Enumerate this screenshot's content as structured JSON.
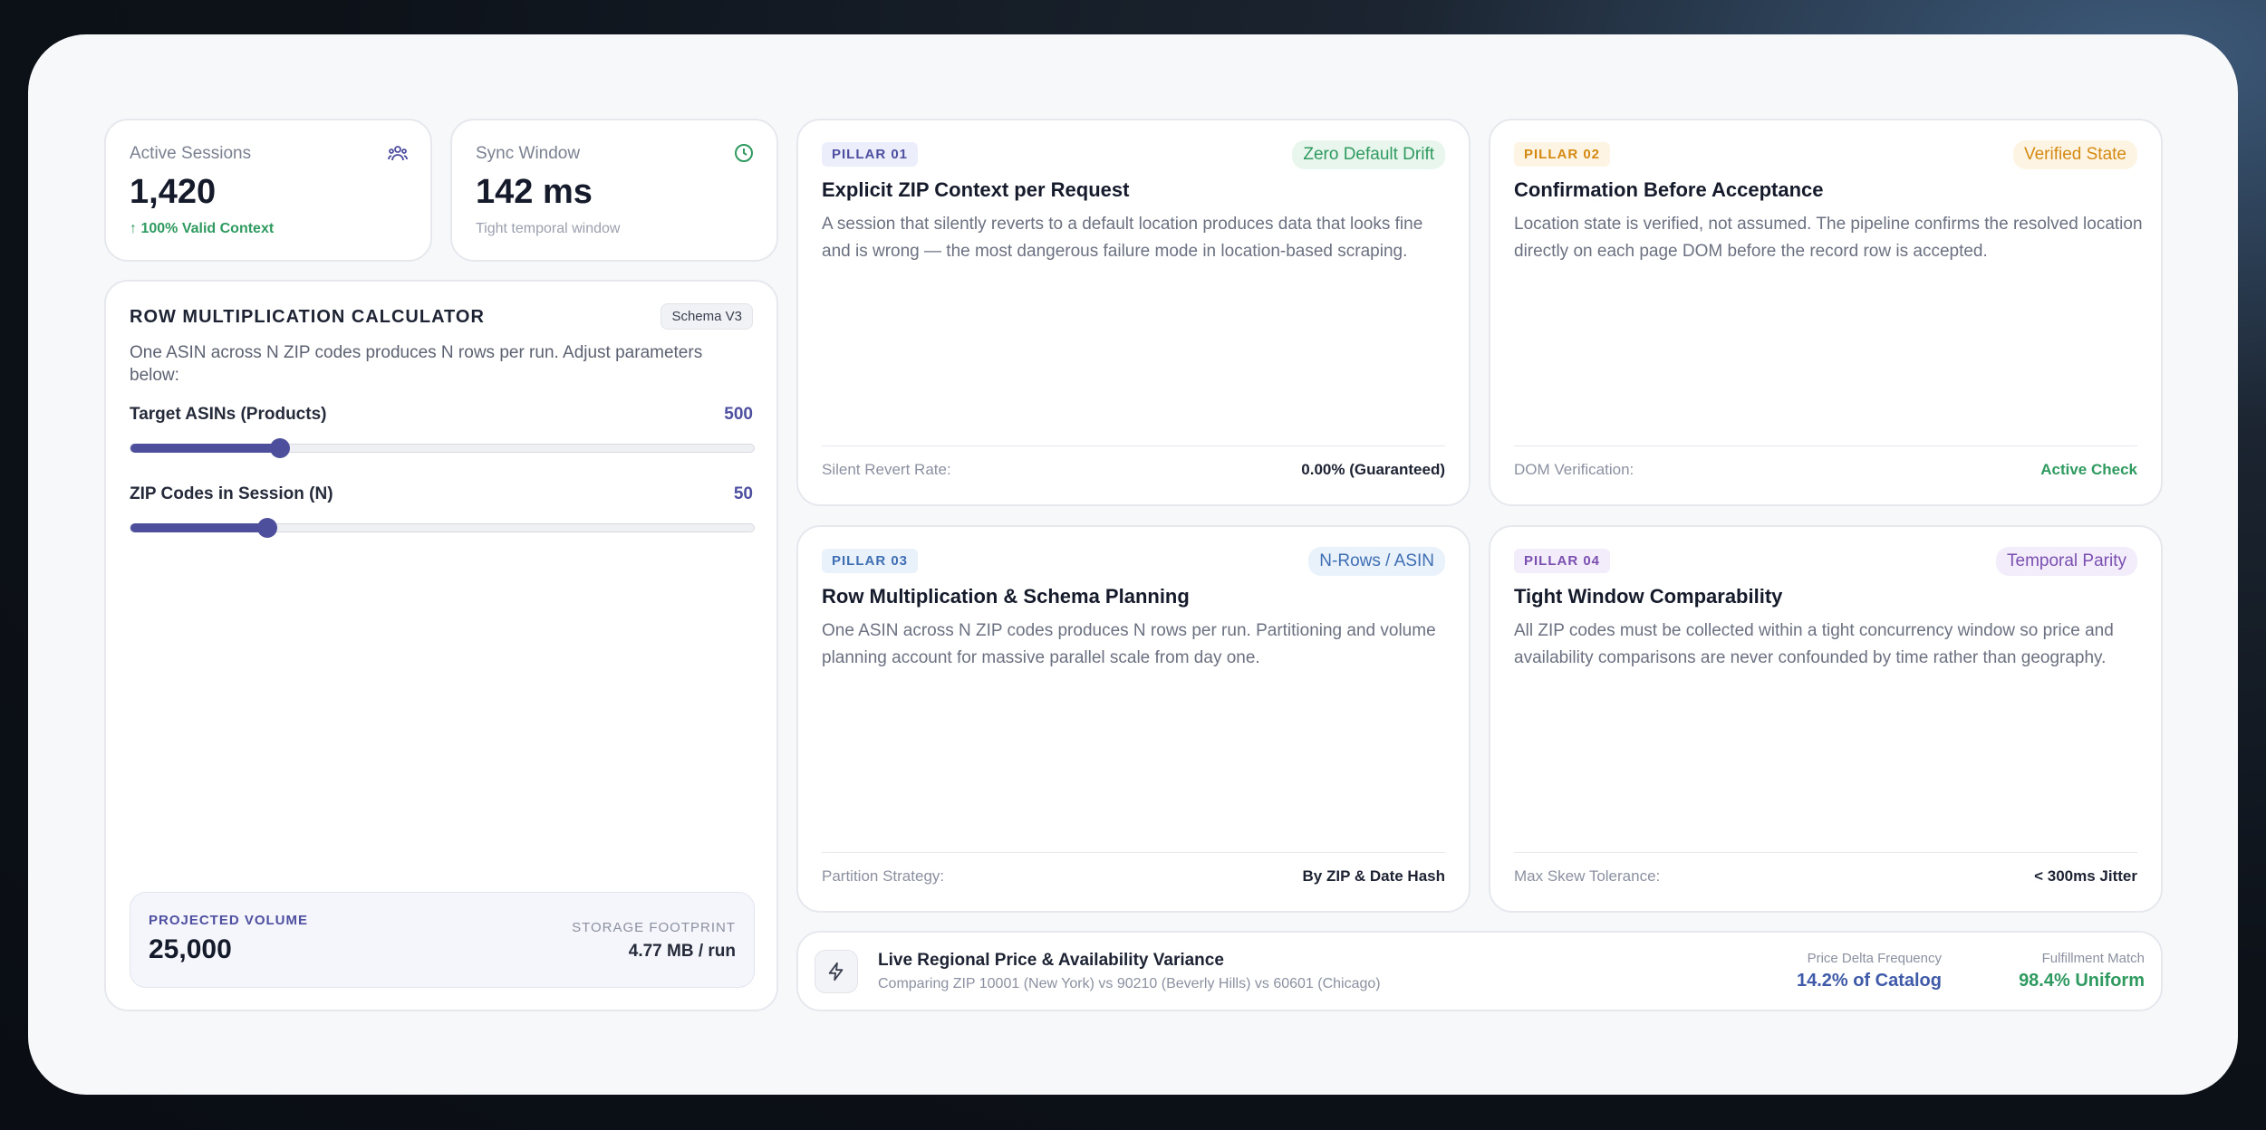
{
  "stats": {
    "active_sessions": {
      "label": "Active Sessions",
      "value": "1,420",
      "sub": "↑ 100% Valid Context",
      "icon": "users-icon"
    },
    "sync_window": {
      "label": "Sync Window",
      "value": "142 ms",
      "sub": "Tight temporal window",
      "icon": "clock-icon"
    }
  },
  "calculator": {
    "title": "ROW MULTIPLICATION CALCULATOR",
    "schema_badge": "Schema V3",
    "description": "One ASIN across N ZIP codes produces N rows per run. Adjust parameters below:",
    "sliders": [
      {
        "label": "Target ASINs (Products)",
        "value": "500",
        "fraction": 0.24
      },
      {
        "label": "ZIP Codes in Session (N)",
        "value": "50",
        "fraction": 0.22
      }
    ],
    "projected": {
      "label": "PROJECTED VOLUME",
      "value": "25,000"
    },
    "storage": {
      "label": "STORAGE FOOTPRINT",
      "value": "4.77 MB / run"
    }
  },
  "pillars": [
    {
      "num": "PILLAR 01",
      "tag": "Zero Default Drift",
      "title": "Explicit ZIP Context per Request",
      "description": "A session that silently reverts to a default location produces data that looks fine and is wrong — the most dangerous failure mode in location-based scraping.",
      "foot_label": "Silent Revert Rate:",
      "foot_value": "0.00% (Guaranteed)",
      "colors": {
        "num_bg": "#eceefb",
        "num_fg": "#4e4fa0",
        "tag_bg": "#e9f6ee",
        "tag_fg": "#2f9a5f"
      }
    },
    {
      "num": "PILLAR 02",
      "tag": "Verified State",
      "title": "Confirmation Before Acceptance",
      "description": "Location state is verified, not assumed. The pipeline confirms the resolved location directly on each page DOM before the record row is accepted.",
      "foot_label": "DOM Verification:",
      "foot_value": "Active Check",
      "colors": {
        "num_bg": "#fdf4e4",
        "num_fg": "#d48a12",
        "tag_bg": "#fdf4e4",
        "tag_fg": "#d48a12",
        "foot_fg": "#2f9a5f"
      }
    },
    {
      "num": "PILLAR 03",
      "tag": "N-Rows / ASIN",
      "title": "Row Multiplication & Schema Planning",
      "description": "One ASIN across N ZIP codes produces N rows per run. Partitioning and volume planning account for massive parallel scale from day one.",
      "foot_label": "Partition Strategy:",
      "foot_value": "By ZIP & Date Hash",
      "colors": {
        "num_bg": "#e9f1fb",
        "num_fg": "#3f6fb3",
        "tag_bg": "#e9f1fb",
        "tag_fg": "#3f6fb3"
      }
    },
    {
      "num": "PILLAR 04",
      "tag": "Temporal Parity",
      "title": "Tight Window Comparability",
      "description": "All ZIP codes must be collected within a tight concurrency window so price and availability comparisons are never confounded by time rather than geography.",
      "foot_label": "Max Skew Tolerance:",
      "foot_value": "< 300ms Jitter",
      "colors": {
        "num_bg": "#f3edfb",
        "num_fg": "#7a4fb0",
        "tag_bg": "#f3edfb",
        "tag_fg": "#7a4fb0"
      }
    }
  ],
  "live": {
    "icon": "lightning-icon",
    "title": "Live Regional Price & Availability Variance",
    "subtitle": "Comparing ZIP 10001 (New York) vs 90210 (Beverly Hills) vs 60601 (Chicago)",
    "metrics": [
      {
        "label": "Price Delta Frequency",
        "value": "14.2% of Catalog",
        "color": "#3f5aa8"
      },
      {
        "label": "Fulfillment Match",
        "value": "98.4% Uniform",
        "color": "#2f9a5f"
      }
    ]
  }
}
